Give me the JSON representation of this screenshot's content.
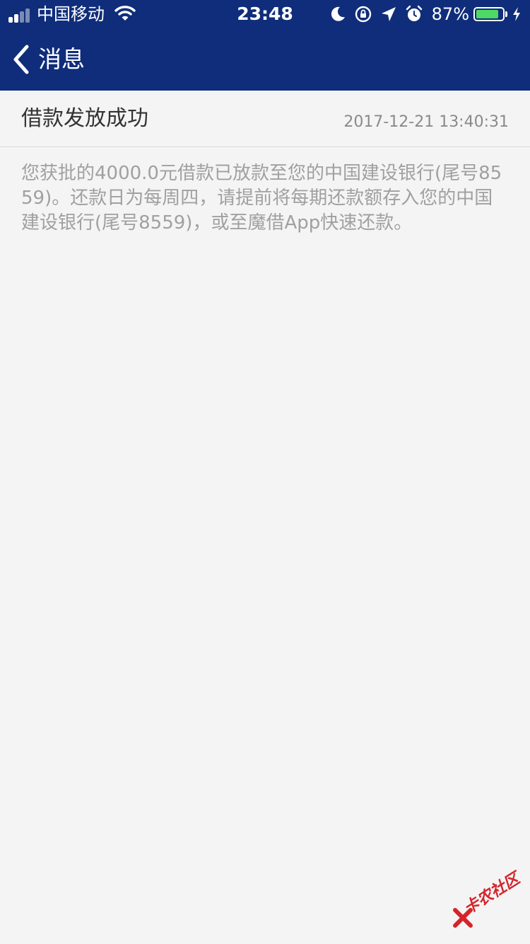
{
  "status_bar": {
    "carrier": "中国移动",
    "time": "23:48",
    "battery_percent": "87%",
    "battery_level": 0.87,
    "signal_bars_filled": 2,
    "signal_bars_total": 4
  },
  "nav": {
    "title": "消息",
    "back_icon": "chevron-left-icon"
  },
  "message": {
    "title": "借款发放成功",
    "timestamp": "2017-12-21 13:40:31",
    "body": "您获批的4000.0元借款已放款至您的中国建设银行(尾号8559)。还款日为每周四，请提前将每期还款额存入您的中国建设银行(尾号8559)，或至魔借App快速还款。"
  },
  "watermark": {
    "text": "卡农社区"
  },
  "colors": {
    "header_bg": "#0f2d7a",
    "page_bg": "#f4f4f4",
    "title_text": "#333333",
    "body_text": "#a0a0a0",
    "battery_fill": "#4cd964",
    "watermark": "#d6232a"
  }
}
